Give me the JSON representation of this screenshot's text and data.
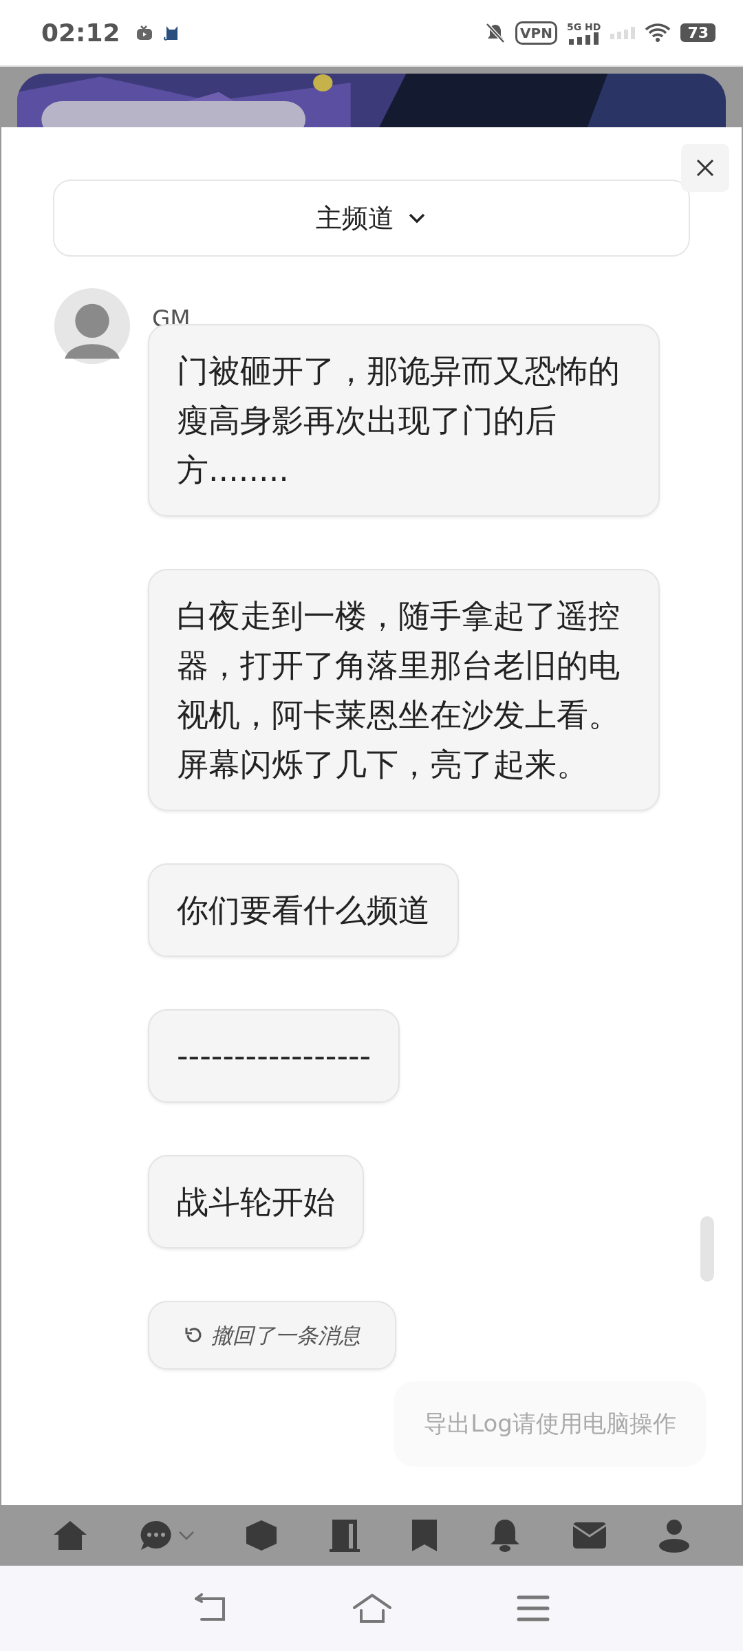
{
  "status_bar": {
    "time": "02:12",
    "vpn": "VPN",
    "network": "5G HD",
    "battery": "73"
  },
  "channel_select": {
    "label": "主频道"
  },
  "messages": [
    {
      "kind": "text",
      "sender": "GM",
      "text": "门被砸开了，那诡异而又恐怖的瘦高身影再次出现了门的后方........"
    },
    {
      "kind": "text",
      "text": "白夜走到一楼，随手拿起了遥控器，打开了角落里那台老旧的电视机，阿卡莱恩坐在沙发上看。屏幕闪烁了几下，亮了起来。"
    },
    {
      "kind": "text",
      "text": "你们要看什么频道"
    },
    {
      "kind": "text",
      "text": "-----------------"
    },
    {
      "kind": "text",
      "text": "战斗轮开始"
    },
    {
      "kind": "withdrawn",
      "text": "撤回了一条消息"
    }
  ],
  "toast": "导出Log请使用电脑操作"
}
